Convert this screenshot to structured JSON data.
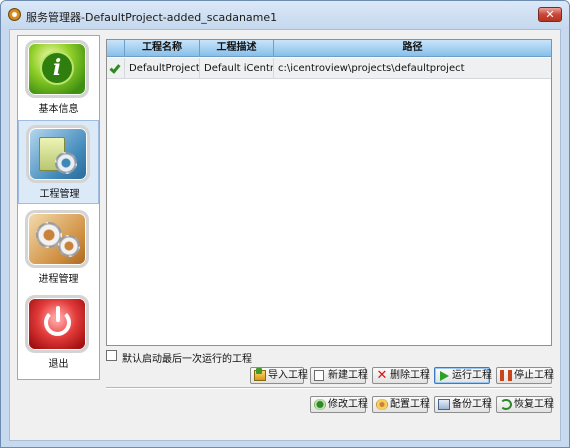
{
  "window": {
    "title": "服务管理器-DefaultProject-added_scadaname1",
    "close_label": "✕"
  },
  "sidebar": {
    "items": [
      {
        "label": "基本信息",
        "icon": "info-icon"
      },
      {
        "label": "工程管理",
        "icon": "project-folder-icon",
        "active": true
      },
      {
        "label": "进程管理",
        "icon": "gears-icon"
      },
      {
        "label": "退出",
        "icon": "power-icon"
      }
    ]
  },
  "table": {
    "headers": [
      "",
      "工程名称",
      "工程描述",
      "路径"
    ],
    "rows": [
      {
        "checked": true,
        "name": "DefaultProject",
        "desc": "Default iCentr...",
        "path": "c:\\icentroview\\projects\\defaultproject"
      }
    ]
  },
  "options": {
    "autostart_label": "默认启动最后一次运行的工程",
    "autostart_checked": false
  },
  "buttons": {
    "import": "导入工程",
    "new": "新建工程",
    "delete": "删除工程",
    "run": "运行工程",
    "stop": "停止工程",
    "modify": "修改工程",
    "config": "配置工程",
    "backup": "备份工程",
    "restore": "恢复工程"
  },
  "colors": {
    "accent": "#87bfe8",
    "title_bar": "#c5d8ee",
    "close": "#c9463a",
    "check": "#2f8a1f"
  }
}
